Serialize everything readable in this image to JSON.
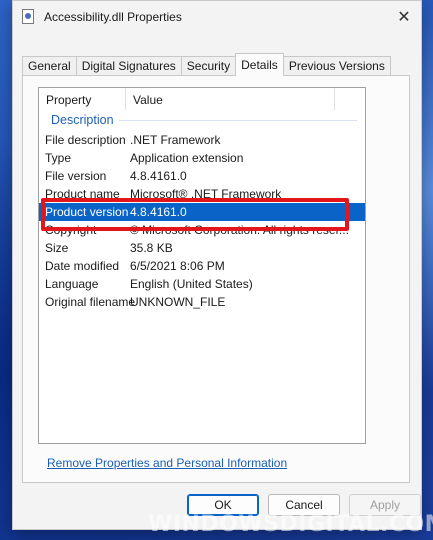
{
  "window": {
    "title": "Accessibility.dll Properties",
    "close_glyph": "✕"
  },
  "tabs": [
    {
      "label": "General",
      "active": false
    },
    {
      "label": "Digital Signatures",
      "active": false
    },
    {
      "label": "Security",
      "active": false
    },
    {
      "label": "Details",
      "active": true
    },
    {
      "label": "Previous Versions",
      "active": false
    }
  ],
  "details": {
    "columns": {
      "property": "Property",
      "value": "Value"
    },
    "group_label": "Description",
    "rows": [
      {
        "key": "File description",
        "value": ".NET Framework"
      },
      {
        "key": "Type",
        "value": "Application extension"
      },
      {
        "key": "File version",
        "value": "4.8.4161.0"
      },
      {
        "key": "Product name",
        "value": "Microsoft® .NET Framework"
      },
      {
        "key": "Product version",
        "value": "4.8.4161.0",
        "selected": true
      },
      {
        "key": "Copyright",
        "value": "© Microsoft Corporation.  All rights reser..."
      },
      {
        "key": "Size",
        "value": "35.8 KB"
      },
      {
        "key": "Date modified",
        "value": "6/5/2021 8:06 PM"
      },
      {
        "key": "Language",
        "value": "English (United States)"
      },
      {
        "key": "Original filename",
        "value": "UNKNOWN_FILE"
      }
    ]
  },
  "remove_link": "Remove Properties and Personal Information",
  "buttons": {
    "ok": "OK",
    "cancel": "Cancel",
    "apply": "Apply"
  },
  "watermark": "WINDOWSDIGITAL.COM",
  "colors": {
    "selection": "#0a64c8",
    "highlight_frame": "#e3171b",
    "group_header": "#1f5fb4"
  }
}
